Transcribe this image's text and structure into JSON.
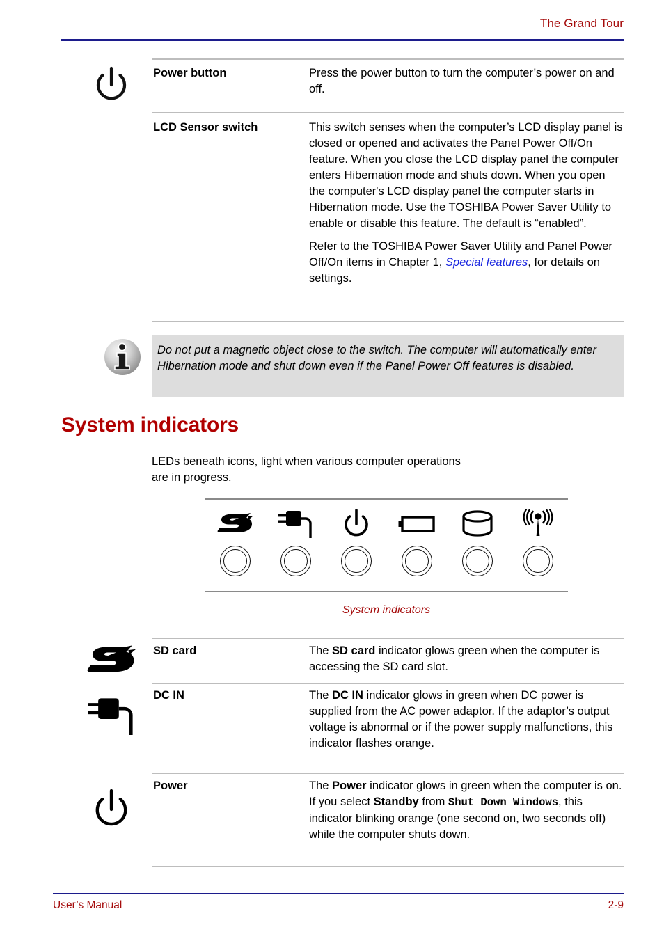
{
  "header": {
    "title": "The Grand Tour"
  },
  "footer": {
    "left": "User’s Manual",
    "right": "2-9"
  },
  "top_table": {
    "rows": [
      {
        "icon": "power-icon",
        "label": "Power button",
        "paragraph1": "Press the power button to turn the computer’s power on and off."
      },
      {
        "icon": "none",
        "label": "LCD Sensor switch",
        "paragraph1": "This switch senses when the computer’s LCD display panel is closed or opened and activates the Panel Power Off/On feature. When you close the LCD display panel the computer enters Hibernation mode and shuts down. When you open the computer's LCD display panel the computer starts in Hibernation mode. Use the TOSHIBA Power Saver Utility to enable or disable this feature. The default is “enabled”.",
        "paragraph2_before": "Refer to the TOSHIBA Power Saver Utility and Panel Power Off/On items in Chapter 1, ",
        "paragraph2_link": "Special features",
        "paragraph2_after": ", for details on settings."
      }
    ]
  },
  "note": {
    "icon": "info-icon",
    "text": "Do not put a magnetic object close to the switch. The computer will automatically enter Hibernation mode and shut down even if the Panel Power Off features is disabled."
  },
  "section": {
    "heading": "System indicators",
    "intro": "LEDs beneath icons, light when various computer operations are in progress."
  },
  "diagram": {
    "caption": "System indicators",
    "cells": [
      {
        "icon": "sd-card-icon"
      },
      {
        "icon": "dc-in-plug-icon"
      },
      {
        "icon": "power-icon"
      },
      {
        "icon": "battery-icon"
      },
      {
        "icon": "hard-disk-icon"
      },
      {
        "icon": "wireless-icon"
      }
    ]
  },
  "indicator_table": {
    "rows": [
      {
        "icon": "sd-card-icon",
        "label": "SD card",
        "desc_1": "The ",
        "desc_bold": "SD card",
        "desc_2": " indicator glows green when the computer is accessing the SD card slot."
      },
      {
        "icon": "dc-in-plug-icon",
        "label": "DC IN",
        "desc_1": "The ",
        "desc_bold": "DC IN",
        "desc_2": " indicator glows in green when DC power is supplied from the AC power adaptor. If the adaptor’s output voltage is abnormal or if the power supply malfunctions, this indicator flashes orange."
      },
      {
        "icon": "power-icon",
        "label": "Power",
        "desc_1": "The ",
        "desc_bold": "Power",
        "desc_2": " indicator glows in green when the computer is on. If you select ",
        "desc_bold2": "Standby",
        "desc_3": " from ",
        "desc_mono": "Shut Down Windows",
        "desc_4": ", this indicator blinking orange (one second on, two seconds off) while the computer shuts down."
      }
    ]
  },
  "colors": {
    "accent_red": "#a50c0c",
    "heading_red": "#b00000",
    "rule_navy": "#1c1c8c",
    "link_blue": "#1a26e0",
    "table_rule": "#bdbdbd",
    "note_bg": "#dddddd"
  }
}
